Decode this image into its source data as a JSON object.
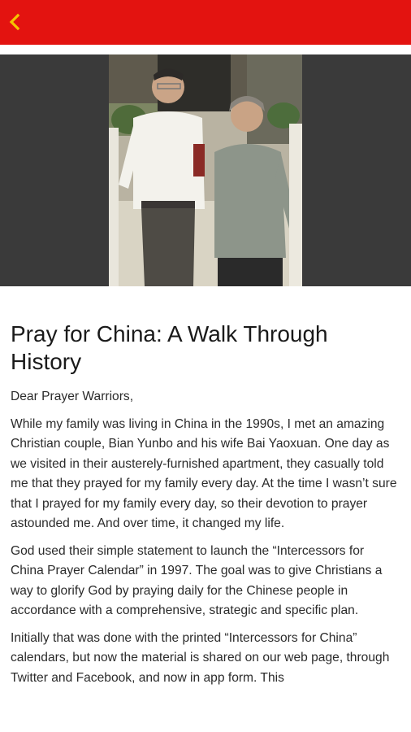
{
  "header": {
    "back_icon": "chevron-left-icon",
    "accent_color": "#e31310",
    "icon_color": "#f5c400"
  },
  "article": {
    "title": "Pray for China: A Walk Through History",
    "greeting": "Dear Prayer Warriors,",
    "paragraphs": [
      "While my family was living in China in the 1990s, I met an amazing Christian couple, Bian Yunbo and his wife Bai Yaoxuan. One day as we visited in their austerely-furnished apartment, they casually told me that they prayed for my family every day. At the time I wasn’t sure that I prayed for my family every day, so their devotion to prayer astounded me. And over time, it changed my life.",
      "God used their simple statement to launch the “Intercessors for China Prayer Calendar” in 1997. The goal was to give Christians a way to glorify God by praying daily for the Chinese people in accordance with a comprehensive, strategic and specific plan.",
      "Initially that was done with the printed “Intercessors for China” calendars, but now the material is shared on our web page, through Twitter and Facebook, and now in app form. This"
    ]
  }
}
